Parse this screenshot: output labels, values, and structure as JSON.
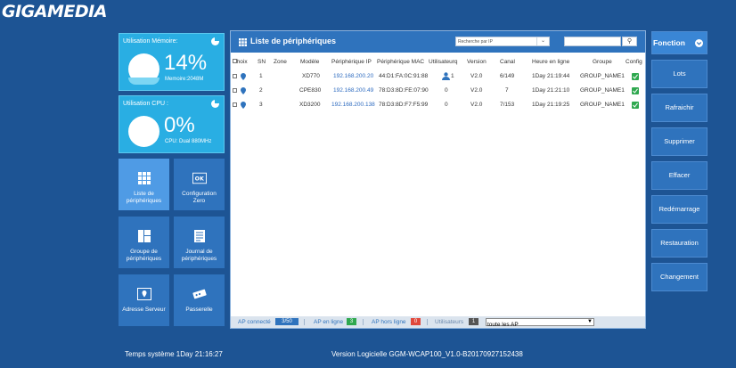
{
  "brand": {
    "logo": "GIGAMEDIA"
  },
  "stats": {
    "memory": {
      "title": "Utilisation Mémoire:",
      "value": "14%",
      "sub": "Memoire:2048M"
    },
    "cpu": {
      "title": "Utilisation CPU :",
      "value": "0%",
      "sub": "CPU: Dual 880MHz"
    }
  },
  "tiles": [
    {
      "label1": "Liste de",
      "label2": "périphériques",
      "icon": "grid-icon",
      "active": true
    },
    {
      "label1": "Configuration",
      "label2": "Zero",
      "icon": "ok-config-icon",
      "active": false
    },
    {
      "label1": "Groupe de",
      "label2": "périphériques",
      "icon": "layout-icon",
      "active": false
    },
    {
      "label1": "Journal de",
      "label2": "périphériques",
      "icon": "journal-icon",
      "active": false
    },
    {
      "label1": "Adresse Serveur",
      "label2": "",
      "icon": "map-pin-icon",
      "active": false
    },
    {
      "label1": "Passerelle",
      "label2": "",
      "icon": "gateway-icon",
      "active": false
    }
  ],
  "panel": {
    "title": "Liste de périphériques",
    "search_select": "Recherche par IP",
    "search_value": "",
    "columns": [
      "Choix",
      "SN",
      "Zone",
      "Modèle",
      "Périphérique IP",
      "Périphérique MAC",
      "Utilisateurq",
      "Version",
      "Canal",
      "Heure en ligne",
      "Groupe",
      "Config"
    ],
    "rows": [
      {
        "sn": "1",
        "zone": "",
        "model": "XD770",
        "ip": "192.168.200.20",
        "mac": "44:D1:FA:0C:91:88",
        "users": "1",
        "user_icon": true,
        "version": "V2.0",
        "channel": "6/149",
        "online": "1Day 21:19:44",
        "group": "GROUP_NAME1"
      },
      {
        "sn": "2",
        "zone": "",
        "model": "CPE830",
        "ip": "192.168.200.49",
        "mac": "78:D3:8D:FE:07:90",
        "users": "0",
        "user_icon": false,
        "version": "V2.0",
        "channel": "7",
        "online": "1Day 21:21:10",
        "group": "GROUP_NAME1"
      },
      {
        "sn": "3",
        "zone": "",
        "model": "XD3200",
        "ip": "192.168.200.138",
        "mac": "78:D3:8D:F7:F5:99",
        "users": "0",
        "user_icon": false,
        "version": "V2.0",
        "channel": "7/153",
        "online": "1Day 21:19:25",
        "group": "GROUP_NAME1"
      }
    ],
    "footer": {
      "ap_connected_label": "AP connecté",
      "ap_connected_value": "3/50",
      "ap_online_label": "AP en ligne",
      "ap_online_value": "3",
      "ap_offline_label": "AP hors ligne",
      "ap_offline_value": "0",
      "users_label": "Utilisateurs",
      "users_value": "1",
      "filter_value": "toute les AP"
    }
  },
  "functions": {
    "title": "Fonction",
    "buttons": [
      "Lots",
      "Rafraichir",
      "Supprimer",
      "Effacer",
      "Redémarrage",
      "Restauration",
      "Changement"
    ]
  },
  "footer": {
    "system_time": "Temps système  1Day 21:16:27",
    "version": "Version Logicielle  GGM-WCAP100_V1.0-B20170927152438"
  },
  "colors": {
    "background": "#1d5494",
    "tile": "#2f73bd",
    "tile_active": "#4f9be5",
    "stat": "#29aee3",
    "connected_badge": "#2f73bd",
    "online_badge": "#2fa84f",
    "offline_badge": "#e0483c",
    "users_badge": "#555555"
  }
}
